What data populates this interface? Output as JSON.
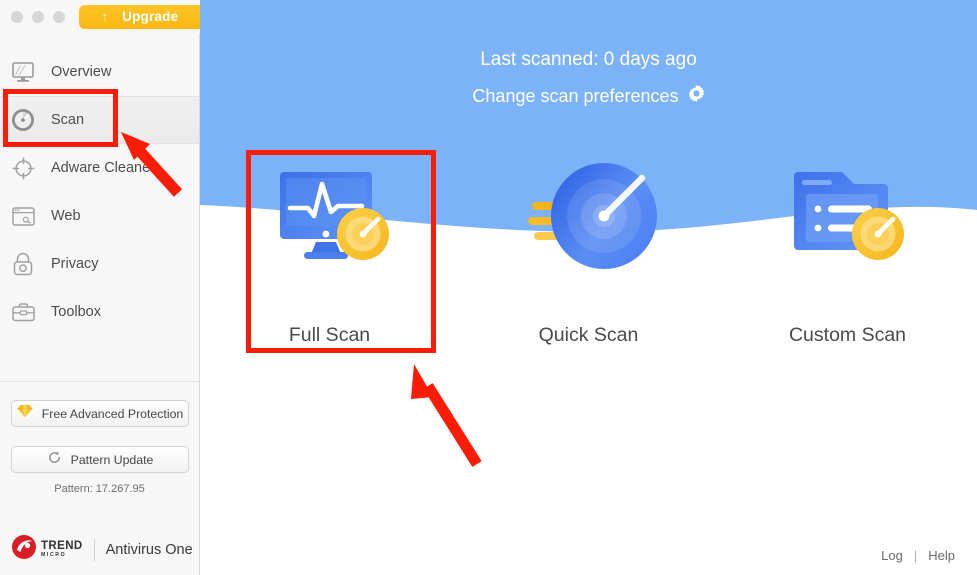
{
  "window": {
    "traffic_lights": [
      "close",
      "minimize",
      "zoom"
    ],
    "upgrade_button": {
      "label": "Upgrade",
      "icon": "up-arrow-icon",
      "color": "#fcbb16"
    }
  },
  "sidebar": {
    "items": [
      {
        "label": "Overview",
        "icon": "monitor-icon",
        "active": false
      },
      {
        "label": "Scan",
        "icon": "scan-gauge-icon",
        "active": true
      },
      {
        "label": "Adware Cleaner",
        "icon": "crosshair-icon",
        "active": false
      },
      {
        "label": "Web",
        "icon": "browser-window-icon",
        "active": false
      },
      {
        "label": "Privacy",
        "icon": "padlock-icon",
        "active": false
      },
      {
        "label": "Toolbox",
        "icon": "toolbox-icon",
        "active": false
      }
    ],
    "free_advanced_protection": {
      "label": "Free Advanced Protection",
      "icon": "diamond-icon"
    },
    "pattern_update": {
      "label": "Pattern Update",
      "icon": "refresh-icon"
    },
    "pattern_version": "Pattern: 17.267.95",
    "brand": {
      "logo_icon": "trend-micro-logo-icon",
      "logo_line1": "TREND",
      "logo_line2": "MICRO",
      "product": "Antivirus One"
    }
  },
  "header": {
    "last_scanned": "Last scanned: 0 days ago",
    "change_preferences": "Change scan preferences",
    "gear_icon": "gear-icon",
    "background_color": "#7cb2f7"
  },
  "scan_options": [
    {
      "label": "Full Scan",
      "icon": "monitor-pulse-scan-icon",
      "highlighted": true
    },
    {
      "label": "Quick Scan",
      "icon": "radar-scan-icon",
      "highlighted": false
    },
    {
      "label": "Custom Scan",
      "icon": "folder-list-scan-icon",
      "highlighted": false
    }
  ],
  "footer": {
    "log": "Log",
    "separator": "|",
    "help": "Help"
  },
  "annotations": {
    "highlight_color": "#f91c06",
    "boxes": [
      "scan-sidebar-item",
      "full-scan-option"
    ],
    "arrows": [
      "arrow-to-scan-item",
      "arrow-to-full-scan"
    ]
  }
}
